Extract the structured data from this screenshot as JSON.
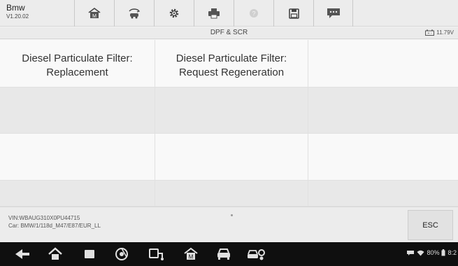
{
  "header": {
    "app_name": "Bmw",
    "version": "V1.20.02",
    "toolbar": [
      {
        "icon": "home-icon"
      },
      {
        "icon": "vehicle-swap-icon"
      },
      {
        "icon": "settings-gear-icon"
      },
      {
        "icon": "print-icon"
      },
      {
        "icon": "help-icon"
      },
      {
        "icon": "save-icon"
      },
      {
        "icon": "message-icon"
      }
    ]
  },
  "titlebar": {
    "title": "DPF & SCR",
    "battery_voltage": "11.79V"
  },
  "grid": {
    "items": [
      {
        "label": "Diesel Particulate Filter: Replacement"
      },
      {
        "label": "Diesel Particulate Filter: Request Regeneration"
      },
      {
        "label": ""
      },
      {
        "label": ""
      },
      {
        "label": ""
      },
      {
        "label": ""
      },
      {
        "label": ""
      },
      {
        "label": ""
      },
      {
        "label": ""
      },
      {
        "label": ""
      },
      {
        "label": ""
      },
      {
        "label": ""
      }
    ]
  },
  "footer": {
    "vin": "VIN:WBAUG310X0PU44715",
    "car": "Car: BMW/1/118d_M47/E87/EUR_LL",
    "esc_label": "ESC"
  },
  "system_bar": {
    "battery_percent": "80%",
    "time": "8:2"
  },
  "colors": {
    "header_bg": "#ececec",
    "cell_shade": "#e8e8e8",
    "nav_bg": "#0f0f0f"
  }
}
